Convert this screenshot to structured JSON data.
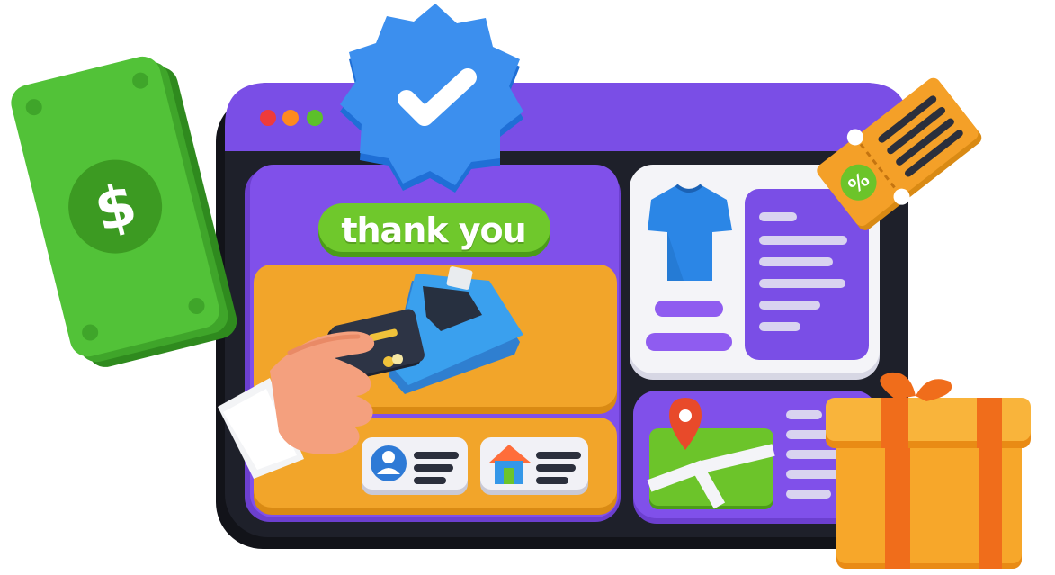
{
  "banner": {
    "text": "thank you"
  },
  "colors": {
    "window_purple": "#7a4ee6",
    "window_dark": "#1b1d27",
    "panel_orange": "#f0a225",
    "accent_green": "#6cc42a",
    "badge_blue": "#2e8be8",
    "ticket_orange": "#f4a028"
  },
  "icons": {
    "money": "dollar-bills-icon",
    "badge": "verified-check-badge-icon",
    "ticket": "discount-ticket-icon",
    "terminal": "card-payment-terminal-icon",
    "shirt": "tshirt-icon",
    "map": "map-pin-icon",
    "gift": "gift-box-icon",
    "user": "user-card-icon",
    "home": "home-card-icon"
  }
}
